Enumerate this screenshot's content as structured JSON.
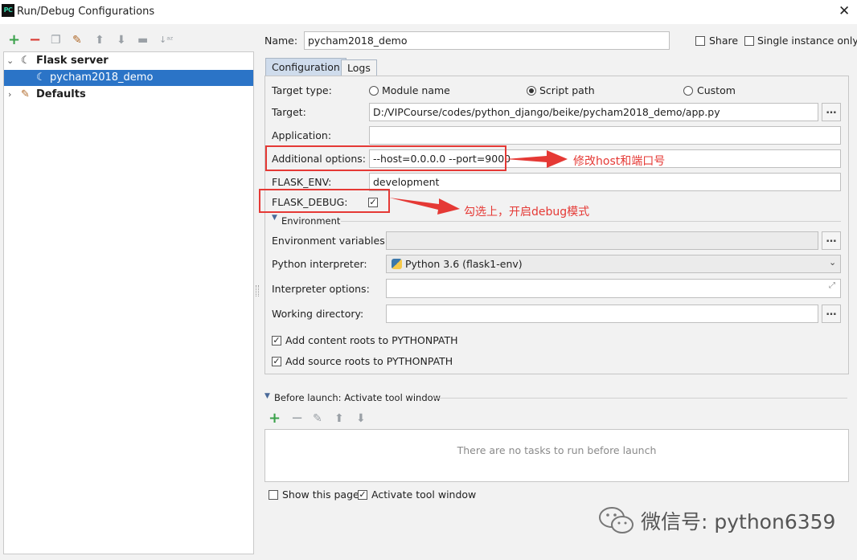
{
  "window": {
    "title": "Run/Debug Configurations",
    "app_icon": "PC"
  },
  "left": {
    "tree": [
      {
        "label": "Flask server",
        "expanded": true
      },
      {
        "label": "pycham2018_demo",
        "selected": true
      },
      {
        "label": "Defaults",
        "expanded": false
      }
    ]
  },
  "header": {
    "name_label": "Name:",
    "name_value": "pycham2018_demo",
    "share_label": "Share",
    "single_instance_label": "Single instance only"
  },
  "tabs": [
    {
      "label": "Configuration",
      "active": true
    },
    {
      "label": "Logs",
      "active": false
    }
  ],
  "config": {
    "target_type_label": "Target type:",
    "radio_module": "Module name",
    "radio_script": "Script path",
    "radio_custom": "Custom",
    "target_label": "Target:",
    "target_value": "D:/VIPCourse/codes/python_django/beike/pycham2018_demo/app.py",
    "application_label": "Application:",
    "application_value": "",
    "additional_label": "Additional options:",
    "additional_value": "--host=0.0.0.0 --port=9000",
    "flask_env_label": "FLASK_ENV:",
    "flask_env_value": "development",
    "flask_debug_label": "FLASK_DEBUG:",
    "flask_debug_checked": true,
    "environment_section": "Environment",
    "env_vars_label": "Environment variables:",
    "env_vars_value": "",
    "interpreter_label": "Python interpreter:",
    "interpreter_value": "Python 3.6 (flask1-env)",
    "interp_options_label": "Interpreter options:",
    "interp_options_value": "",
    "working_dir_label": "Working directory:",
    "working_dir_value": "",
    "add_content_roots": "Add content roots to PYTHONPATH",
    "add_source_roots": "Add source roots to PYTHONPATH"
  },
  "annotations": {
    "note1": "修改host和端口号",
    "note2": "勾选上，开启debug模式"
  },
  "before_launch": {
    "title": "Before launch: Activate tool window",
    "empty_text": "There are no tasks to run before launch",
    "show_page": "Show this page",
    "activate_window": "Activate tool window"
  },
  "watermark": "微信号: python6359",
  "colors": {
    "accent": "#2b74c7",
    "annotation": "#e53935",
    "add_green": "#3aa14a",
    "remove_red": "#d9382f"
  }
}
